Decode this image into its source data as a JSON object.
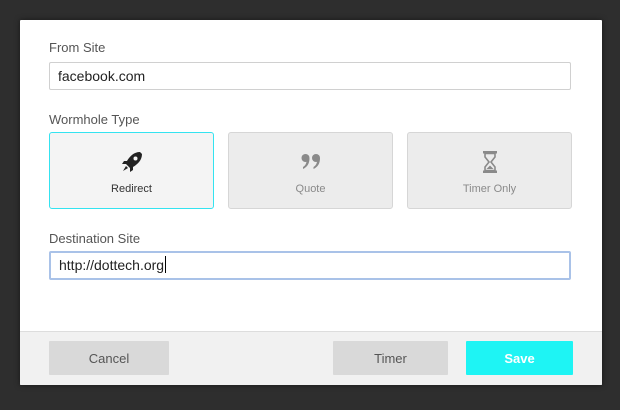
{
  "form": {
    "from_label": "From Site",
    "from_value": "facebook.com",
    "type_label": "Wormhole Type",
    "destination_label": "Destination Site",
    "destination_value": "http://dottech.org"
  },
  "wormhole_types": [
    {
      "label": "Redirect",
      "icon": "rocket-icon",
      "selected": true
    },
    {
      "label": "Quote",
      "icon": "quote-icon",
      "selected": false
    },
    {
      "label": "Timer Only",
      "icon": "hourglass-icon",
      "selected": false
    }
  ],
  "footer": {
    "cancel_label": "Cancel",
    "timer_label": "Timer",
    "save_label": "Save"
  },
  "colors": {
    "accent": "#1ef4f4",
    "selected_border": "#34e3f0",
    "focus_border": "#a9c2e8"
  }
}
